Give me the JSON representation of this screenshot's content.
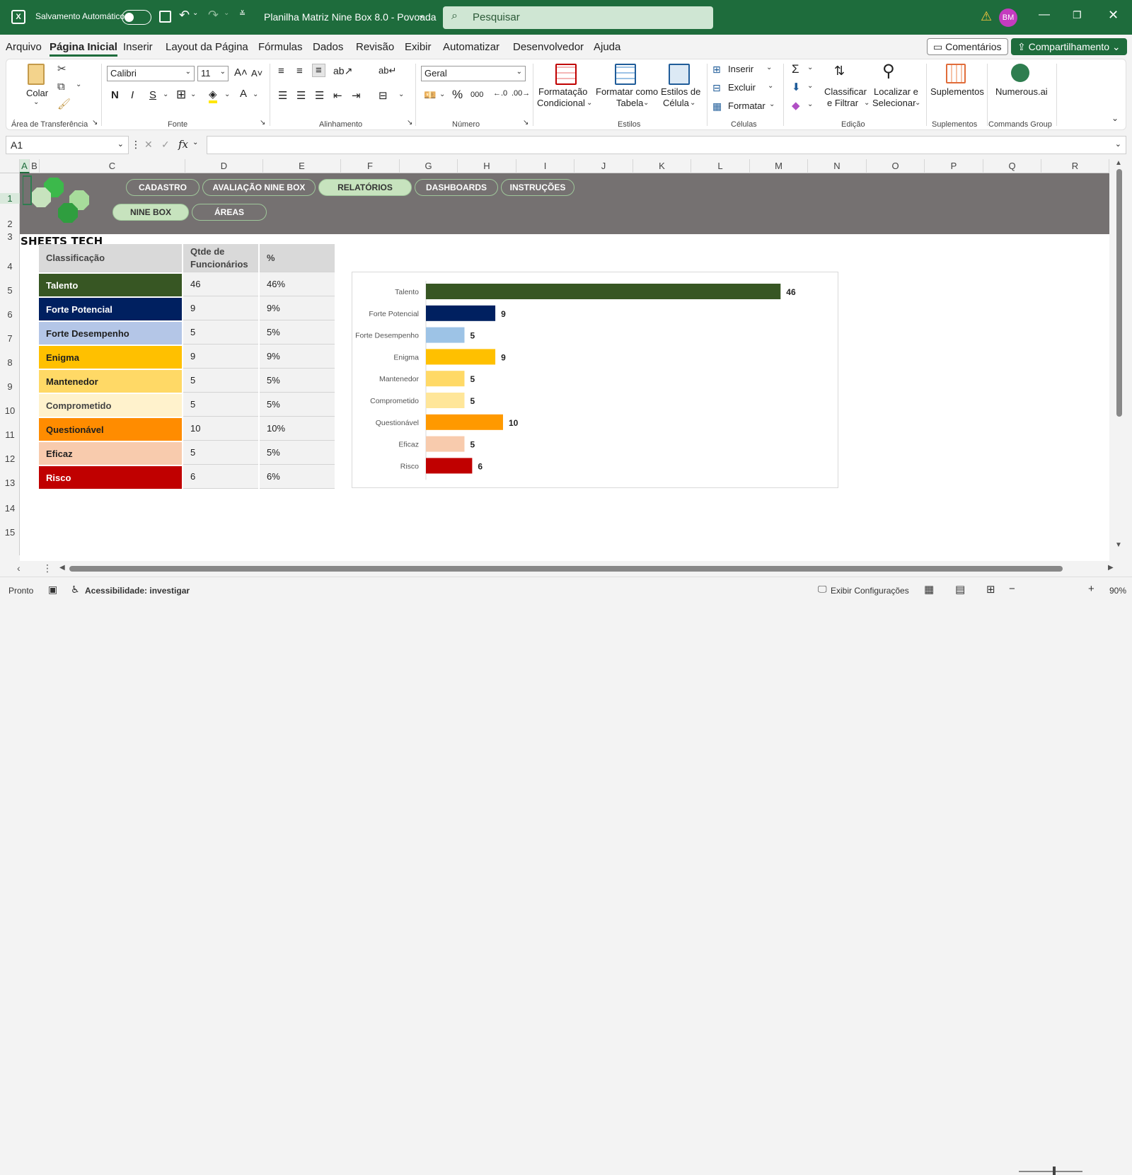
{
  "titlebar": {
    "autosave_label": "Salvamento Automático",
    "doc_title": "Planilha Matriz Nine Box 8.0 - Povoada",
    "search_placeholder": "Pesquisar",
    "avatar_initials": "BM"
  },
  "menu": {
    "items": [
      "Arquivo",
      "Página Inicial",
      "Inserir",
      "Layout da Página",
      "Fórmulas",
      "Dados",
      "Revisão",
      "Exibir",
      "Automatizar",
      "Desenvolvedor",
      "Ajuda"
    ],
    "comments_label": "Comentários",
    "share_label": "Compartilhamento"
  },
  "ribbon": {
    "paste_label": "Colar",
    "clipboard_group": "Área de Transferência",
    "font_name": "Calibri",
    "font_size": "11",
    "font_group": "Fonte",
    "bold": "N",
    "italic": "I",
    "underline": "S",
    "alignment_group": "Alinhamento",
    "number_format": "Geral",
    "number_group": "Número",
    "percent": "%",
    "thousands": "000",
    "cond_format_l1": "Formatação",
    "cond_format_l2": "Condicional",
    "format_table_l1": "Formatar como",
    "format_table_l2": "Tabela",
    "cell_styles_l1": "Estilos de",
    "cell_styles_l2": "Célula",
    "styles_group": "Estilos",
    "insert": "Inserir",
    "delete": "Excluir",
    "format": "Formatar",
    "cells_group": "Células",
    "sort_l1": "Classificar",
    "sort_l2": "e Filtrar",
    "find_l1": "Localizar e",
    "find_l2": "Selecionar",
    "editing_group": "Edição",
    "addins": "Suplementos",
    "addins_group": "Suplementos",
    "numerous": "Numerous.ai",
    "commands_group": "Commands Group"
  },
  "formula_bar": {
    "name_box": "A1",
    "fx": "fx"
  },
  "columns": [
    "A",
    "B",
    "C",
    "D",
    "E",
    "F",
    "G",
    "H",
    "I",
    "J",
    "K",
    "L",
    "M",
    "N",
    "O",
    "P",
    "Q",
    "R"
  ],
  "rows": [
    "1",
    "2",
    "3",
    "4",
    "5",
    "6",
    "7",
    "8",
    "9",
    "10",
    "11",
    "12",
    "13",
    "14",
    "15"
  ],
  "nav": {
    "cadastro": "CADASTRO",
    "avaliacao": "AVALIAÇÃO NINE BOX",
    "relatorios": "RELATÓRIOS",
    "dashboards": "DASHBOARDS",
    "instrucoes": "INSTRUÇÕES",
    "nine_box": "NINE BOX",
    "areas": "ÁREAS"
  },
  "brand": "SHEETS TECH",
  "table": {
    "headers": [
      "Classificação",
      "Qtde de Funcionários",
      "%"
    ],
    "rows": [
      {
        "name": "Talento",
        "qty": "46",
        "pct": "46%",
        "color": "#375623",
        "text": "#ffffff"
      },
      {
        "name": "Forte Potencial",
        "qty": "9",
        "pct": "9%",
        "color": "#002060",
        "text": "#ffffff"
      },
      {
        "name": "Forte Desempenho",
        "qty": "5",
        "pct": "5%",
        "color": "#b4c6e7",
        "text": "#1f1f1f"
      },
      {
        "name": "Enigma",
        "qty": "9",
        "pct": "9%",
        "color": "#ffc000",
        "text": "#1f1f1f"
      },
      {
        "name": "Mantenedor",
        "qty": "5",
        "pct": "5%",
        "color": "#ffd966",
        "text": "#1f1f1f"
      },
      {
        "name": "Comprometido",
        "qty": "5",
        "pct": "5%",
        "color": "#fff2cc",
        "text": "#444444"
      },
      {
        "name": "Questionável",
        "qty": "10",
        "pct": "10%",
        "color": "#ff8c00",
        "text": "#1f1f1f"
      },
      {
        "name": "Eficaz",
        "qty": "5",
        "pct": "5%",
        "color": "#f8cbad",
        "text": "#1f1f1f"
      },
      {
        "name": "Risco",
        "qty": "6",
        "pct": "6%",
        "color": "#c00000",
        "text": "#ffffff"
      }
    ]
  },
  "chart_data": {
    "type": "bar",
    "orientation": "horizontal",
    "categories": [
      "Talento",
      "Forte Potencial",
      "Forte Desempenho",
      "Enigma",
      "Mantenedor",
      "Comprometido",
      "Questionável",
      "Eficaz",
      "Risco"
    ],
    "values": [
      46,
      9,
      5,
      9,
      5,
      5,
      10,
      5,
      6
    ],
    "colors": [
      "#375623",
      "#002060",
      "#9dc3e6",
      "#ffc000",
      "#ffd966",
      "#ffe699",
      "#ff9900",
      "#f8cbad",
      "#c00000"
    ],
    "xlim": [
      0,
      50
    ],
    "title": "",
    "xlabel": "",
    "ylabel": ""
  },
  "status": {
    "ready": "Pronto",
    "accessibility": "Acessibilidade: investigar",
    "display_settings": "Exibir Configurações",
    "zoom": "90%"
  },
  "colors": {
    "title_bar": "#1e6c3c",
    "banner": "#757171",
    "nav_active": "#c7e3be"
  }
}
